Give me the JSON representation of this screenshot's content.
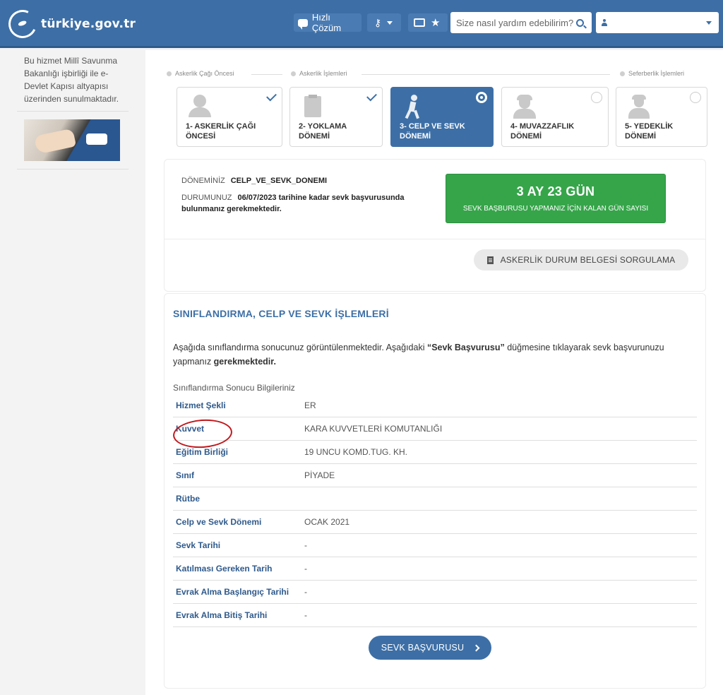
{
  "header": {
    "logo_text": "türkiye.gov.tr",
    "quick_solution_label": "Hızlı Çözüm",
    "search_placeholder": "Size nasıl yardım edebilirim?",
    "user_name": ""
  },
  "sidebar": {
    "info_text": "Bu hizmet Millî Savunma Bakanlığı işbirliği ile e-Devlet Kapısı altyapısı üzerinden sunulmaktadır."
  },
  "steps": {
    "group_labels": [
      "Askerlik Çağı Öncesi",
      "Askerlik İşlemleri",
      "Seferberlik İşlemleri"
    ],
    "items": [
      {
        "label": "1- ASKERLİK ÇAĞI ÖNCESİ",
        "state": "completed",
        "icon": "person-icon"
      },
      {
        "label": "2- YOKLAMA DÖNEMİ",
        "state": "completed",
        "icon": "clipboard-icon"
      },
      {
        "label": "3- CELP VE SEVK DÖNEMİ",
        "state": "active",
        "icon": "walking-person-icon"
      },
      {
        "label": "4- MUVAZZAFLIK DÖNEMİ",
        "state": "pending",
        "icon": "soldier-icon"
      },
      {
        "label": "5- YEDEKLİK DÖNEMİ",
        "state": "pending",
        "icon": "reserve-soldier-icon"
      }
    ]
  },
  "status": {
    "period_label": "DÖNEMİNİZ",
    "period_value": "CELP_VE_SEVK_DONEMI",
    "state_label": "DURUMUNUZ",
    "state_value": "06/07/2023 tarihine kadar sevk başvurusunda bulunmanız gerekmektedir.",
    "countdown": "3 AY 23 GÜN",
    "countdown_caption": "SEVK BAŞBURUSU YAPMANIZ İÇİN KALAN GÜN SAYISI",
    "doc_button_label": "ASKERLİK DURUM BELGESİ SORGULAMA"
  },
  "classification": {
    "title": "SINIFLANDIRMA, CELP VE SEVK İŞLEMLERİ",
    "desc_part1": "Aşağıda sınıflandırma sonucunuz görüntülenmektedir. Aşağıdaki ",
    "desc_bold": "“Sevk Başvurusu”",
    "desc_part2": " düğmesine tıklayarak sevk başvurunuzu yapmanız ",
    "desc_bold2": "gerekmektedir.",
    "subtitle": "Sınıflandırma Sonucu Bilgileriniz",
    "rows": [
      {
        "key": "Hizmet Şekli",
        "value": "ER"
      },
      {
        "key": "Kuvvet",
        "value": "KARA KUVVETLERİ KOMUTANLIĞI"
      },
      {
        "key": "Eğitim Birliği",
        "value": "19 UNCU KOMD.TUG. KH."
      },
      {
        "key": "Sınıf",
        "value": "PİYADE"
      },
      {
        "key": "Rütbe",
        "value": ""
      },
      {
        "key": "Celp ve Sevk Dönemi",
        "value": "OCAK 2021"
      },
      {
        "key": "Sevk Tarihi",
        "value": "-"
      },
      {
        "key": "Katılması Gereken Tarih",
        "value": "-"
      },
      {
        "key": "Evrak Alma Başlangıç Tarihi",
        "value": "-"
      },
      {
        "key": "Evrak Alma Bitiş Tarihi",
        "value": "-"
      }
    ],
    "apply_button_label": "SEVK BAŞVURUSU"
  },
  "colors": {
    "brand_blue": "#3d6fa6",
    "success_green": "#36a54a",
    "highlight_red": "#c0181c"
  }
}
